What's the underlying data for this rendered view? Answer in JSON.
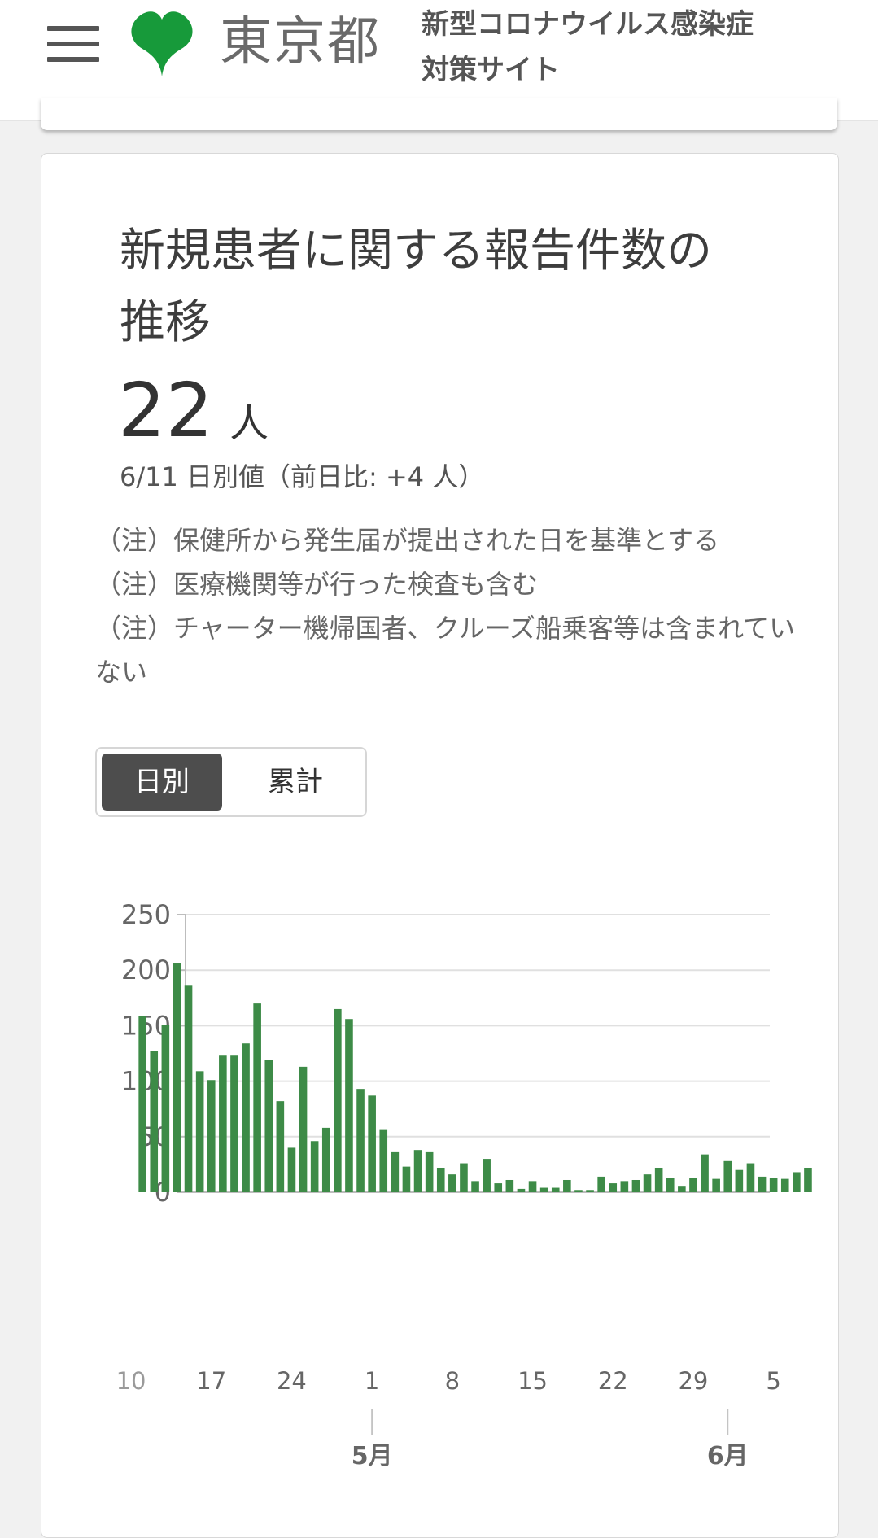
{
  "header": {
    "logo_text": "東京都",
    "site_title_line1": "新型コロナウイルス感染症",
    "site_title_line2": "対策サイト"
  },
  "card": {
    "title": "新規患者に関する報告件数の推移",
    "value": "22",
    "unit": "人",
    "sub": "6/11 日別値（前日比: +4 人）",
    "notes": [
      "（注）保健所から発生届が提出された日を基準とする",
      "（注）医療機関等が行った検査も含む",
      "（注）チャーター機帰国者、クルーズ船乗客等は含まれていない"
    ],
    "toggle": {
      "daily": "日別",
      "cumulative": "累計"
    }
  },
  "colors": {
    "bar": "#3d8b47",
    "grid": "#e0e0e0",
    "axis": "#bdbdbd",
    "active_toggle": "#4d4d4d"
  },
  "chart_data": {
    "type": "bar",
    "first_day": 11,
    "values": [
      159,
      127,
      151,
      206,
      186,
      109,
      101,
      123,
      123,
      134,
      170,
      119,
      82,
      40,
      113,
      46,
      58,
      165,
      156,
      93,
      87,
      56,
      36,
      23,
      38,
      36,
      22,
      16,
      26,
      10,
      30,
      8,
      11,
      3,
      10,
      4,
      4,
      11,
      2,
      2,
      14,
      8,
      10,
      11,
      16,
      22,
      13,
      5,
      13,
      34,
      12,
      28,
      20,
      26,
      14,
      13,
      12,
      18,
      22
    ],
    "ylim": [
      0,
      250
    ],
    "yticks": [
      0,
      50,
      100,
      150,
      200,
      250
    ],
    "xtick_labels": [
      "10",
      "17",
      "24",
      "1",
      "8",
      "15",
      "22",
      "29",
      "5"
    ],
    "months": [
      "5月",
      "6月"
    ],
    "grid": true
  }
}
